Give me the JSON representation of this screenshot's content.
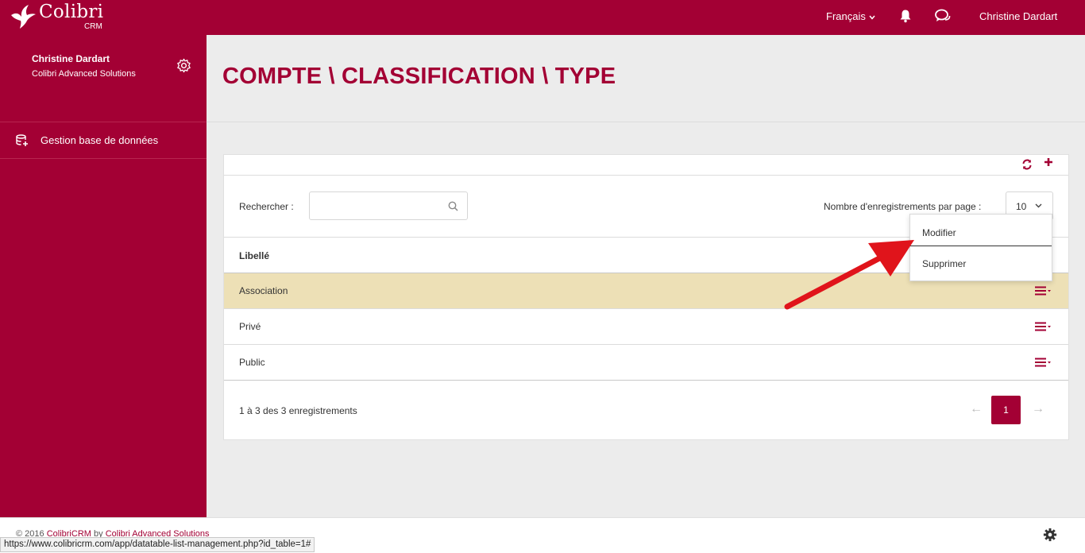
{
  "header": {
    "logo_name": "Colibri",
    "logo_sub": "CRM",
    "language": "Français",
    "user": "Christine Dardart"
  },
  "sidebar": {
    "profile_name": "Christine Dardart",
    "profile_company": "Colibri Advanced Solutions",
    "items": [
      {
        "label": "Gestion base de données",
        "icon": "database-add-icon"
      }
    ]
  },
  "page": {
    "title": "COMPTE \\ CLASSIFICATION \\ TYPE"
  },
  "table": {
    "search_label": "Rechercher :",
    "search_value": "",
    "per_page_label": "Nombre d'enregistrements par page :",
    "per_page_value": "10",
    "columns": [
      "Libellé"
    ],
    "rows": [
      {
        "label": "Association",
        "highlighted": true
      },
      {
        "label": "Privé",
        "highlighted": false
      },
      {
        "label": "Public",
        "highlighted": false
      }
    ],
    "info": "1 à 3 des 3 enregistrements",
    "pagination": {
      "prev": "←",
      "current": "1",
      "next": "→"
    }
  },
  "row_menu": {
    "items": [
      "Modifier",
      "Supprimer"
    ]
  },
  "footer": {
    "copyright_prefix": "© 2016",
    "brand_link": "ColibriCRM",
    "by_text": "by",
    "company_link": "Colibri Advanced Solutions"
  },
  "status_url": "https://www.colibricrm.com/app/datatable-list-management.php?id_table=1#",
  "colors": {
    "brand": "#a30034",
    "row_highlight": "#ede0b6",
    "annotation_arrow": "#e0141b"
  }
}
